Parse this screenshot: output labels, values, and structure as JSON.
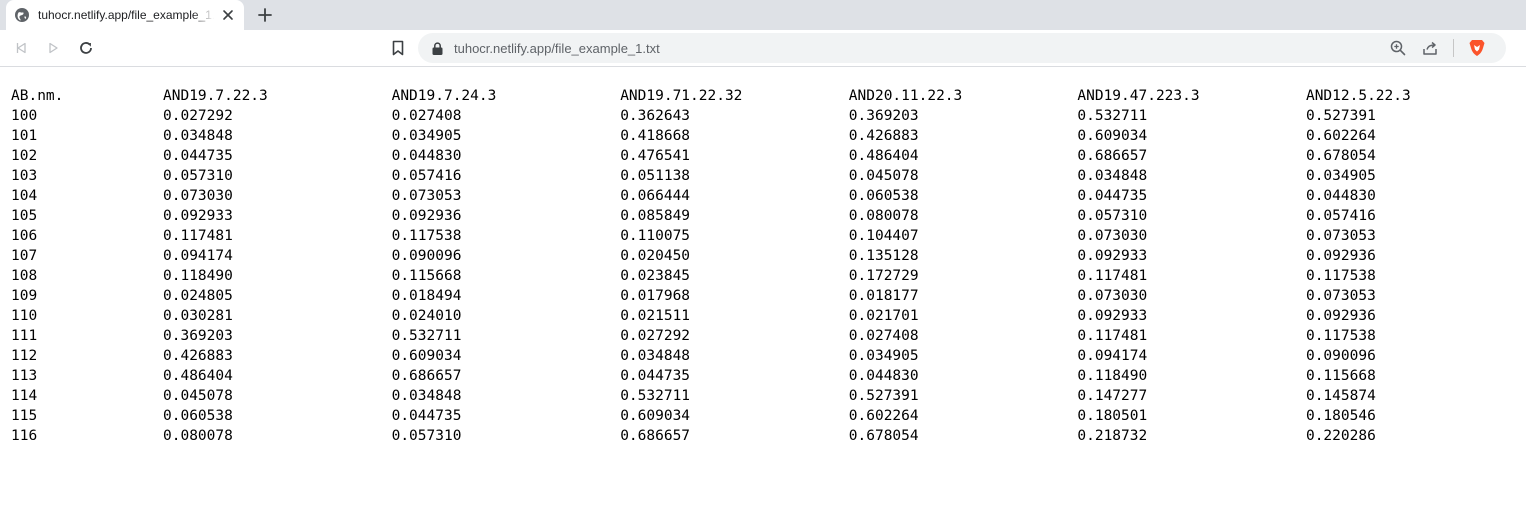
{
  "browser": {
    "tab": {
      "title": "tuhocr.netlify.app/file_example_1.txt",
      "favicon": "globe-icon",
      "close_icon": "close-icon"
    },
    "new_tab_icon": "plus-icon",
    "toolbar": {
      "back_icon": "back-arrow-icon",
      "forward_icon": "forward-arrow-icon",
      "reload_icon": "reload-icon",
      "bookmark_icon": "bookmark-icon",
      "lock_icon": "lock-icon",
      "url": "tuhocr.netlify.app/file_example_1.txt",
      "zoom_icon": "zoom-icon",
      "share_icon": "share-icon",
      "brave_icon": "brave-lion-icon"
    },
    "colors": {
      "tabstrip": "#dee1e6",
      "omnibox": "#f1f3f4",
      "brave_accent": "#fb542b"
    }
  },
  "file": {
    "headers": [
      "AB.nm.",
      "AND19.7.22.3",
      "AND19.7.24.3",
      "AND19.71.22.32",
      "AND20.11.22.3",
      "AND19.47.223.3",
      "AND12.5.22.3"
    ],
    "rows": [
      [
        "100",
        "0.027292",
        "0.027408",
        "0.362643",
        "0.369203",
        "0.532711",
        "0.527391"
      ],
      [
        "101",
        "0.034848",
        "0.034905",
        "0.418668",
        "0.426883",
        "0.609034",
        "0.602264"
      ],
      [
        "102",
        "0.044735",
        "0.044830",
        "0.476541",
        "0.486404",
        "0.686657",
        "0.678054"
      ],
      [
        "103",
        "0.057310",
        "0.057416",
        "0.051138",
        "0.045078",
        "0.034848",
        "0.034905"
      ],
      [
        "104",
        "0.073030",
        "0.073053",
        "0.066444",
        "0.060538",
        "0.044735",
        "0.044830"
      ],
      [
        "105",
        "0.092933",
        "0.092936",
        "0.085849",
        "0.080078",
        "0.057310",
        "0.057416"
      ],
      [
        "106",
        "0.117481",
        "0.117538",
        "0.110075",
        "0.104407",
        "0.073030",
        "0.073053"
      ],
      [
        "107",
        "0.094174",
        "0.090096",
        "0.020450",
        "0.135128",
        "0.092933",
        "0.092936"
      ],
      [
        "108",
        "0.118490",
        "0.115668",
        "0.023845",
        "0.172729",
        "0.117481",
        "0.117538"
      ],
      [
        "109",
        "0.024805",
        "0.018494",
        "0.017968",
        "0.018177",
        "0.073030",
        "0.073053"
      ],
      [
        "110",
        "0.030281",
        "0.024010",
        "0.021511",
        "0.021701",
        "0.092933",
        "0.092936"
      ],
      [
        "111",
        "0.369203",
        "0.532711",
        "0.027292",
        "0.027408",
        "0.117481",
        "0.117538"
      ],
      [
        "112",
        "0.426883",
        "0.609034",
        "0.034848",
        "0.034905",
        "0.094174",
        "0.090096"
      ],
      [
        "113",
        "0.486404",
        "0.686657",
        "0.044735",
        "0.044830",
        "0.118490",
        "0.115668"
      ],
      [
        "114",
        "0.045078",
        "0.034848",
        "0.532711",
        "0.527391",
        "0.147277",
        "0.145874"
      ],
      [
        "115",
        "0.060538",
        "0.044735",
        "0.609034",
        "0.602264",
        "0.180501",
        "0.180546"
      ],
      [
        "116",
        "0.080078",
        "0.057310",
        "0.686657",
        "0.678054",
        "0.218732",
        "0.220286"
      ]
    ]
  }
}
